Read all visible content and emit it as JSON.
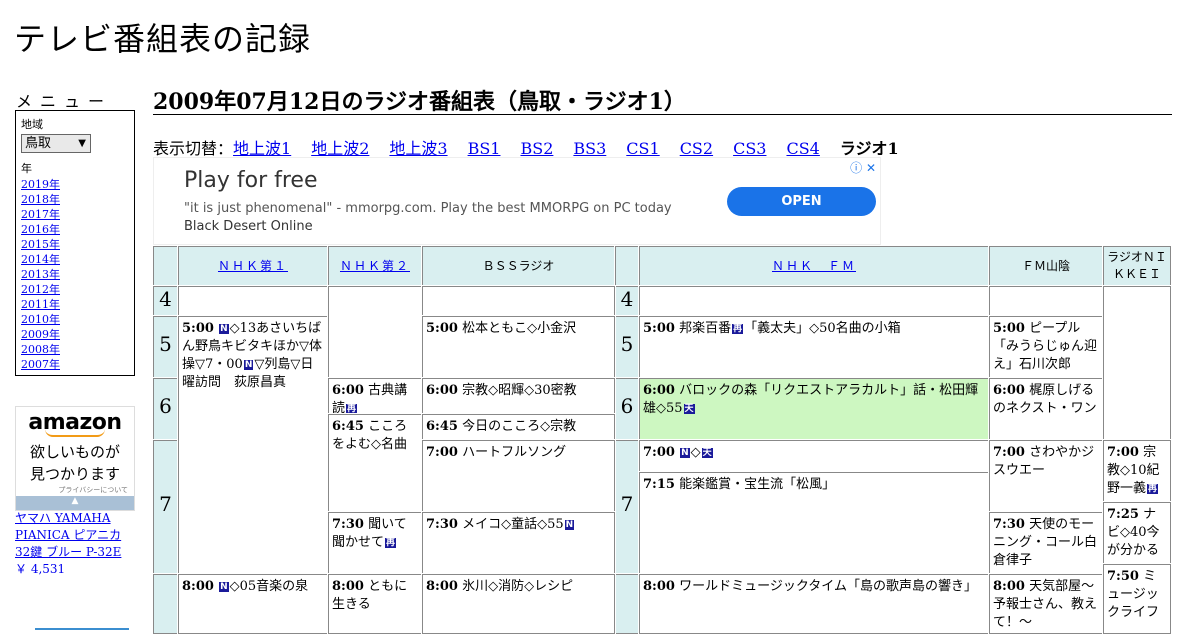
{
  "site": {
    "title": "テレビ番組表の記録"
  },
  "menu": {
    "title": "メニュー",
    "region_label": "地域",
    "region_value": "鳥取",
    "year_label": "年",
    "years": [
      "2019年",
      "2018年",
      "2017年",
      "2016年",
      "2015年",
      "2014年",
      "2013年",
      "2012年",
      "2011年",
      "2010年",
      "2009年",
      "2008年",
      "2007年"
    ]
  },
  "ad_left": {
    "logo": "amazon",
    "tag_line1": "欲しいものが",
    "tag_line2": "見つかります",
    "privacy": "プライバシーについて",
    "product_title": "ヤマハ YAMAHA PIANICA ピアニカ 32鍵 ブルー P-32E",
    "product_price": "￥ 4,531"
  },
  "page": {
    "heading": "2009年07月12日のラジオ番組表（鳥取・ラジオ1）",
    "switch_label": "表示切替：",
    "switch_links": [
      "地上波1",
      "地上波2",
      "地上波3",
      "BS1",
      "BS2",
      "BS3",
      "CS1",
      "CS2",
      "CS3",
      "CS4"
    ],
    "switch_current": "ラジオ1"
  },
  "banner_ad": {
    "title": "Play for free",
    "desc_quote": "\"it is just phenomenal\" - mmorpg.com. Play the best MMORPG on PC today ",
    "desc_bold": "Black Desert Online",
    "button": "OPEN",
    "info_icon": "info-icon",
    "close_icon": "close-icon"
  },
  "icons": {
    "N": "N",
    "rebroadcast": "再",
    "stereo": "天"
  },
  "grid": {
    "headers": [
      "ＮＨＫ第１",
      "ＮＨＫ第２",
      "ＢＳＳラジオ",
      "ＮＨＫ　ＦＭ",
      "ＦＭ山陰",
      "ラジオＮＩＫＫＥＩ"
    ],
    "hours": [
      "4",
      "5",
      "6",
      "7",
      "4",
      "5",
      "6",
      "7"
    ],
    "programs": {
      "nhk1_500": {
        "time": "5:00",
        "a": "◇13あさいちばん野鳥キビタキほか▽体操▽7・00",
        "b": "▽列島▽日曜訪問　荻原昌真"
      },
      "nhk1_800": {
        "time": "8:00",
        "a": "◇05音楽の泉"
      },
      "nhk2_600": {
        "time": "6:00",
        "a": "古典講読"
      },
      "nhk2_645": {
        "time": "6:45",
        "a": "こころをよむ◇名曲"
      },
      "nhk2_730": {
        "time": "7:30",
        "a": "聞いて聞かせて"
      },
      "nhk2_800": {
        "time": "8:00",
        "a": "ともに生きる"
      },
      "bss_500": {
        "time": "5:00",
        "a": "松本ともこ◇小金沢"
      },
      "bss_600": {
        "time": "6:00",
        "a": "宗教◇昭輝◇30密教"
      },
      "bss_645": {
        "time": "6:45",
        "a": "今日のこころ◇宗教"
      },
      "bss_700": {
        "time": "7:00",
        "a": "ハートフルソング"
      },
      "bss_730": {
        "time": "7:30",
        "a": "メイコ◇童話◇55"
      },
      "bss_800": {
        "time": "8:00",
        "a": "氷川◇消防◇レシピ"
      },
      "fm_500": {
        "time": "5:00",
        "a": "邦楽百番",
        "b": "「義太夫」◇50名曲の小箱"
      },
      "fm_600": {
        "time": "6:00",
        "a": "バロックの森「リクエストアラカルト」話・松田輝雄◇55"
      },
      "fm_700": {
        "time": "7:00",
        "a": "◇"
      },
      "fm_715": {
        "time": "7:15",
        "a": "能楽鑑賞・宝生流「松風」"
      },
      "fm_800": {
        "time": "8:00",
        "a": "ワールドミュージックタイム「島の歌声島の響き」"
      },
      "fmsan_500": {
        "time": "5:00",
        "a": "ピープル「みうらじゅん迎え」石川次郎"
      },
      "fmsan_600": {
        "time": "6:00",
        "a": "梶原しげるのネクスト・ワン"
      },
      "fmsan_700": {
        "time": "7:00",
        "a": "さわやかジスウエー"
      },
      "fmsan_730": {
        "time": "7:30",
        "a": "天使のモーニング・コール白倉律子"
      },
      "fmsan_800": {
        "time": "8:00",
        "a": "天気部屋～予報士さん、教えて！～"
      },
      "nikkei_700": {
        "time": "7:00",
        "a": "宗教◇10紀野一義"
      },
      "nikkei_725": {
        "time": "7:25",
        "a": "ナビ◇40今が分かる"
      },
      "nikkei_750": {
        "time": "7:50",
        "a": "ミュージックライフ"
      }
    }
  }
}
